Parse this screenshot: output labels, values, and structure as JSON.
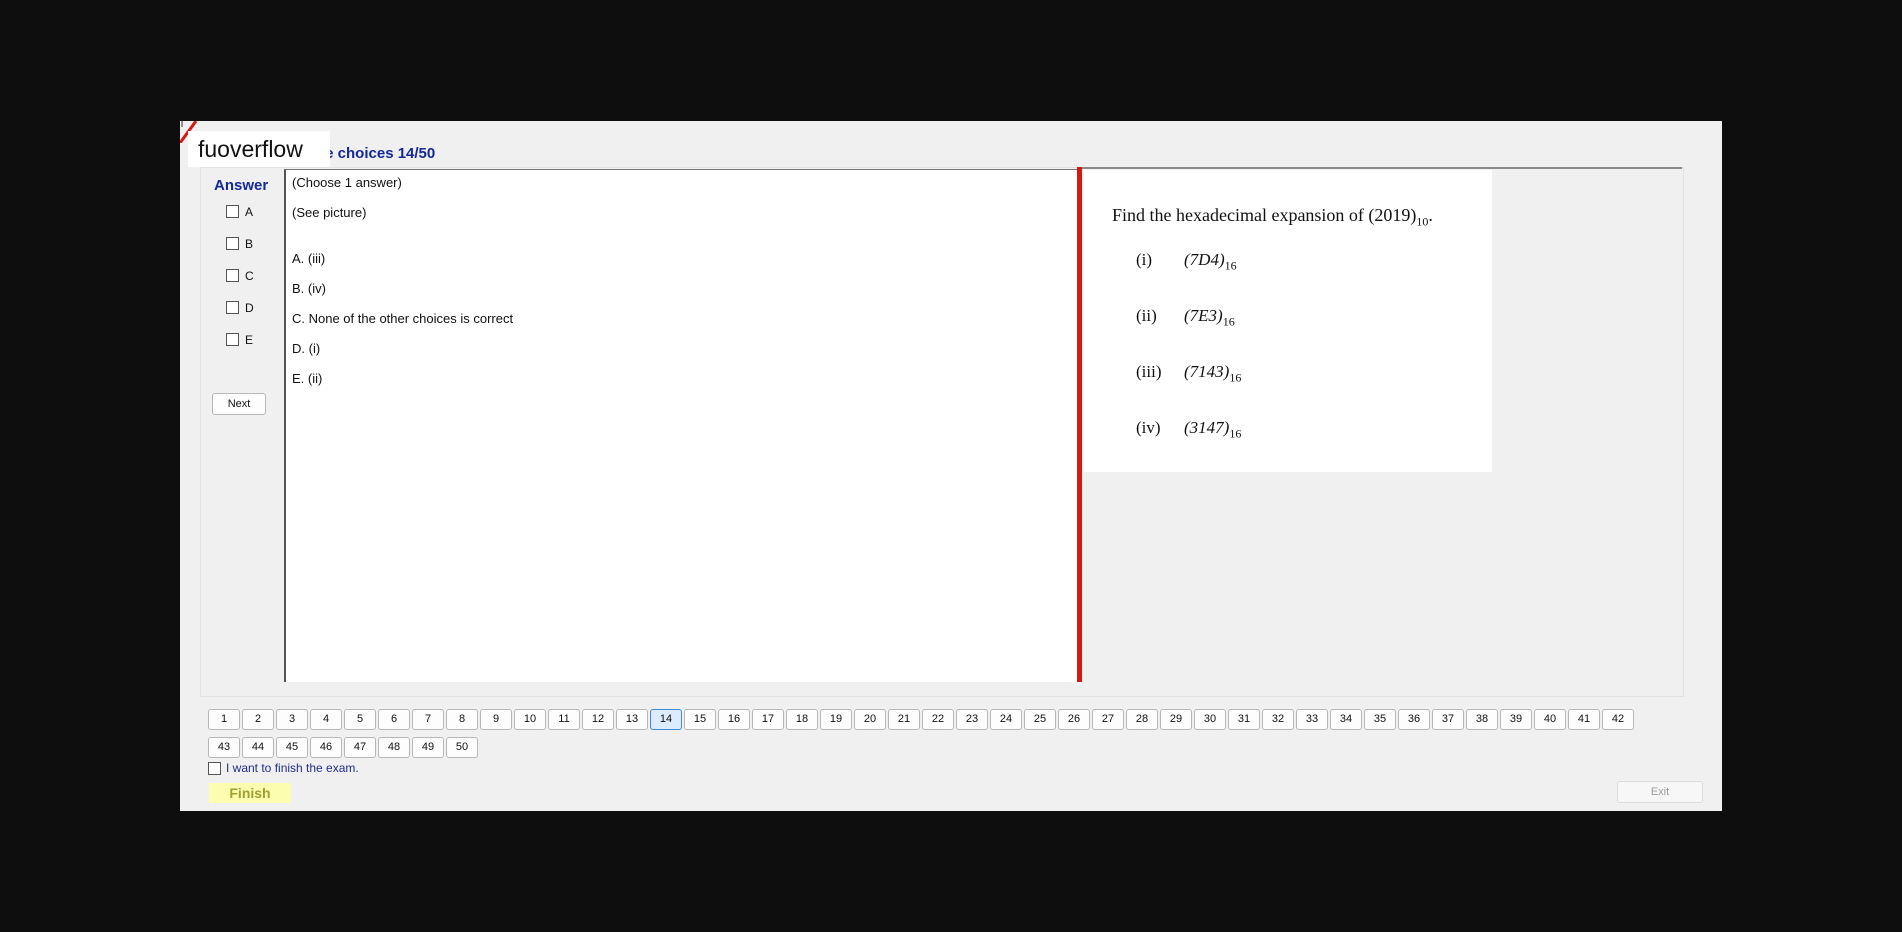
{
  "watermark": "fuoverflow",
  "title": "le choices 14/50",
  "answer_panel": {
    "heading": "Answer",
    "options": [
      "A",
      "B",
      "C",
      "D",
      "E"
    ],
    "next_label": "Next"
  },
  "question": {
    "instruction": "(Choose 1 answer)",
    "note": "(See picture)",
    "choices": [
      "A.  (iii)",
      "B.  (iv)",
      "C.  None of the other choices is correct",
      "D.  (i)",
      "E.  (ii)"
    ]
  },
  "picture": {
    "question_text": "Find the hexadecimal expansion of (2019)",
    "question_base": "10",
    "question_end": ".",
    "items": [
      {
        "roman": "(i)",
        "value": "(7D4)",
        "base": "16"
      },
      {
        "roman": "(ii)",
        "value": "(7E3)",
        "base": "16"
      },
      {
        "roman": "(iii)",
        "value": "(7143)",
        "base": "16"
      },
      {
        "roman": "(iv)",
        "value": "(3147)",
        "base": "16"
      }
    ]
  },
  "pages": {
    "row1": [
      "1",
      "2",
      "3",
      "4",
      "5",
      "6",
      "7",
      "8",
      "9",
      "10",
      "11",
      "12",
      "13",
      "14",
      "15",
      "16",
      "17",
      "18",
      "19",
      "20",
      "21",
      "22",
      "23",
      "24",
      "25",
      "26",
      "27",
      "28",
      "29",
      "30",
      "31",
      "32",
      "33",
      "34",
      "35",
      "36",
      "37",
      "38",
      "39",
      "40",
      "41",
      "42"
    ],
    "row2": [
      "43",
      "44",
      "45",
      "46",
      "47",
      "48",
      "49",
      "50"
    ],
    "current": "14"
  },
  "finish_check_label": "I want to finish the exam.",
  "finish_label": "Finish",
  "exit_label": "Exit",
  "colors": {
    "accent": "#14289a",
    "divider": "#d21b10",
    "finish_bg": "#fdfdb0",
    "current_page": "#dcecfc"
  }
}
